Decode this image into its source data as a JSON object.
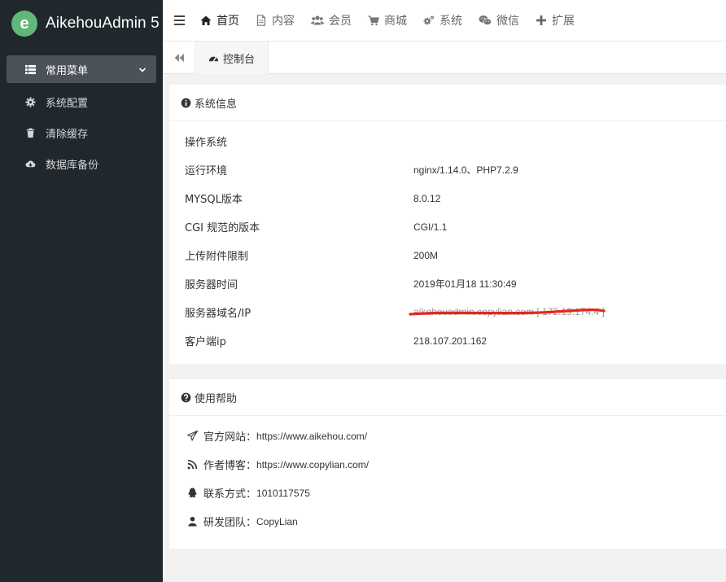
{
  "app": {
    "logo_letter": "e",
    "title": "AikehouAdmin 5",
    "brand_color": "#5fb878"
  },
  "sidebar": {
    "group_label": "常用菜单",
    "items": [
      {
        "label": "系统配置",
        "icon": "gear-icon"
      },
      {
        "label": "清除缓存",
        "icon": "trash-icon"
      },
      {
        "label": "数据库备份",
        "icon": "cloud-download-icon"
      }
    ]
  },
  "nav": {
    "items": [
      {
        "label": "首页",
        "icon": "home-icon",
        "active": true
      },
      {
        "label": "内容",
        "icon": "file-icon"
      },
      {
        "label": "会员",
        "icon": "users-icon"
      },
      {
        "label": "商城",
        "icon": "cart-icon"
      },
      {
        "label": "系统",
        "icon": "gears-icon"
      },
      {
        "label": "微信",
        "icon": "wechat-icon"
      },
      {
        "label": "扩展",
        "icon": "plus-icon"
      }
    ]
  },
  "tabs": {
    "active_label": "控制台"
  },
  "system_info": {
    "title": "系统信息",
    "rows": [
      {
        "key": "操作系统",
        "value": ""
      },
      {
        "key": "运行环境",
        "value": "nginx/1.14.0、PHP7.2.9"
      },
      {
        "key": "MYSQL版本",
        "value": "8.0.12"
      },
      {
        "key": "CGI 规范的版本",
        "value": "CGI/1.1"
      },
      {
        "key": "上传附件限制",
        "value": "200M"
      },
      {
        "key": "服务器时间",
        "value": "2019年01月18 11:30:49"
      },
      {
        "key": "服务器域名/IP",
        "value": "aikehouadmin.copylian.com [ 172.19.174.4 ]"
      },
      {
        "key": "客户端ip",
        "value": "218.107.201.162"
      }
    ]
  },
  "help": {
    "title": "使用帮助",
    "rows": [
      {
        "label": "官方网站：",
        "value": "https://www.aikehou.com/",
        "icon": "paper-plane-icon"
      },
      {
        "label": "作者博客：",
        "value": "https://www.copylian.com/",
        "icon": "rss-icon"
      },
      {
        "label": "联系方式：",
        "value": "1010117575",
        "icon": "qq-icon"
      },
      {
        "label": "研发团队：",
        "value": "CopyLian",
        "icon": "user-icon"
      }
    ]
  }
}
